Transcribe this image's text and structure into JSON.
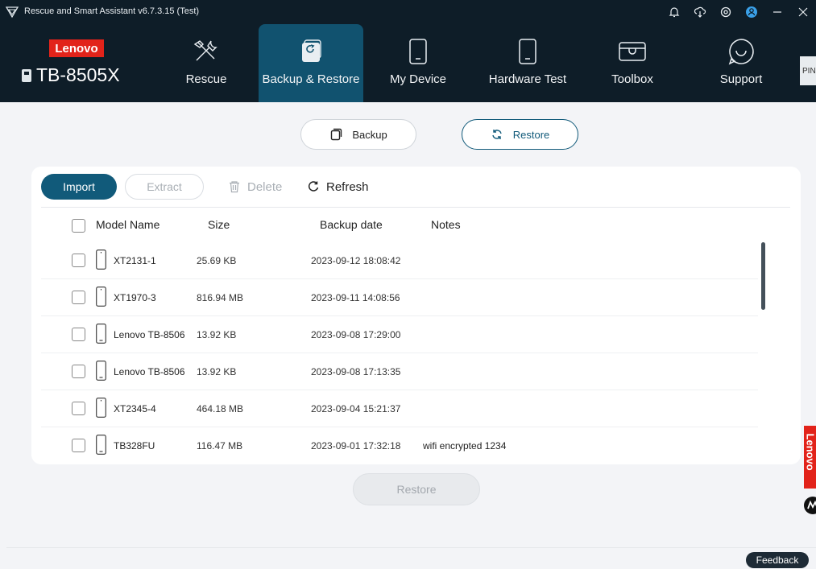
{
  "titlebar": {
    "title": "Rescue and Smart Assistant v6.7.3.15 (Test)",
    "icons": [
      "bell-icon",
      "cloud-download-icon",
      "settings-icon",
      "user-icon",
      "minimize-icon",
      "close-icon"
    ]
  },
  "brand": {
    "logo_text": "Lenovo",
    "device_name": "TB-8505X"
  },
  "nav": {
    "items": [
      {
        "label": "Rescue",
        "icon": "tools-icon"
      },
      {
        "label": "Backup & Restore",
        "icon": "backup-restore-icon"
      },
      {
        "label": "My Device",
        "icon": "phone-icon"
      },
      {
        "label": "Hardware Test",
        "icon": "tablet-icon"
      },
      {
        "label": "Toolbox",
        "icon": "toolbox-icon"
      },
      {
        "label": "Support",
        "icon": "chat-icon"
      }
    ],
    "active": "Backup & Restore",
    "pin_label": "PIN"
  },
  "modes": {
    "backup_label": "Backup",
    "restore_label": "Restore"
  },
  "toolbar": {
    "import_label": "Import",
    "extract_label": "Extract",
    "delete_label": "Delete",
    "refresh_label": "Refresh"
  },
  "table": {
    "headers": {
      "model": "Model Name",
      "size": "Size",
      "date": "Backup date",
      "notes": "Notes"
    },
    "rows": [
      {
        "model": "XT2131-1",
        "size": "25.69 KB",
        "date": "2023-09-12 18:08:42",
        "notes": ""
      },
      {
        "model": "XT1970-3",
        "size": "816.94 MB",
        "date": "2023-09-11 14:08:56",
        "notes": ""
      },
      {
        "model": "Lenovo TB-8506",
        "size": "13.92 KB",
        "date": "2023-09-08 17:29:00",
        "notes": ""
      },
      {
        "model": "Lenovo TB-8506",
        "size": "13.92 KB",
        "date": "2023-09-08 17:13:35",
        "notes": ""
      },
      {
        "model": "XT2345-4",
        "size": "464.18 MB",
        "date": "2023-09-04 15:21:37",
        "notes": ""
      },
      {
        "model": "TB328FU",
        "size": "116.47 MB",
        "date": "2023-09-01 17:32:18",
        "notes": "wifi  encrypted 1234"
      }
    ]
  },
  "restore_button_label": "Restore",
  "feedback_label": "Feedback",
  "side_brand_text": "Lenovo",
  "colors": {
    "nav_bg": "#0e1d28",
    "active_tab": "#11526f",
    "primary": "#115a7a",
    "brand_red": "#e2231a"
  }
}
